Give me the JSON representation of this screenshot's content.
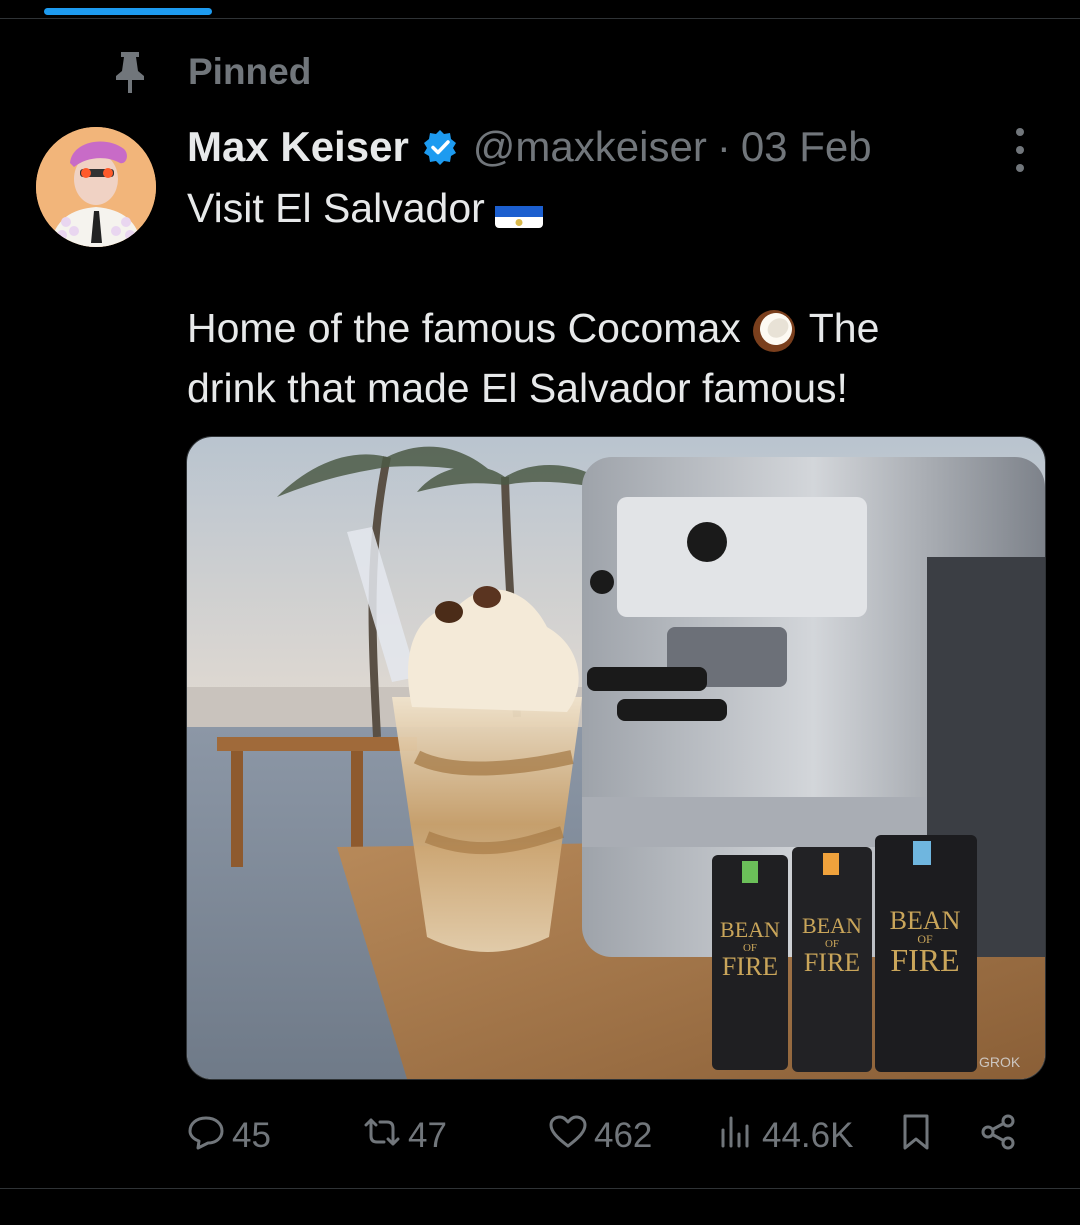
{
  "pinned": {
    "label": "Pinned"
  },
  "tweet": {
    "author_name": "Max Keiser",
    "handle": "@maxkeiser",
    "separator": "·",
    "date": "03 Feb",
    "line1": "Visit El Salvador",
    "line2_a": "Home of the famous Cocomax",
    "line2_b": "The",
    "line3": "drink that made El Salvador famous!",
    "media_text": {
      "can1_line1": "BEAN",
      "can1_of": "OF",
      "can1_line2": "FIRE",
      "can2_line1": "BEAN",
      "can2_of": "OF",
      "can2_line2": "FIRE",
      "can3_line1": "BEAN",
      "can3_of": "OF",
      "can3_line2": "FIRE",
      "watermark": "GROK"
    }
  },
  "actions": {
    "replies": "45",
    "reposts": "47",
    "likes": "462",
    "views": "44.6K"
  },
  "colors": {
    "accent": "#1d9bf0",
    "muted": "#71767b",
    "text": "#e7e9ea",
    "background": "#000000"
  }
}
